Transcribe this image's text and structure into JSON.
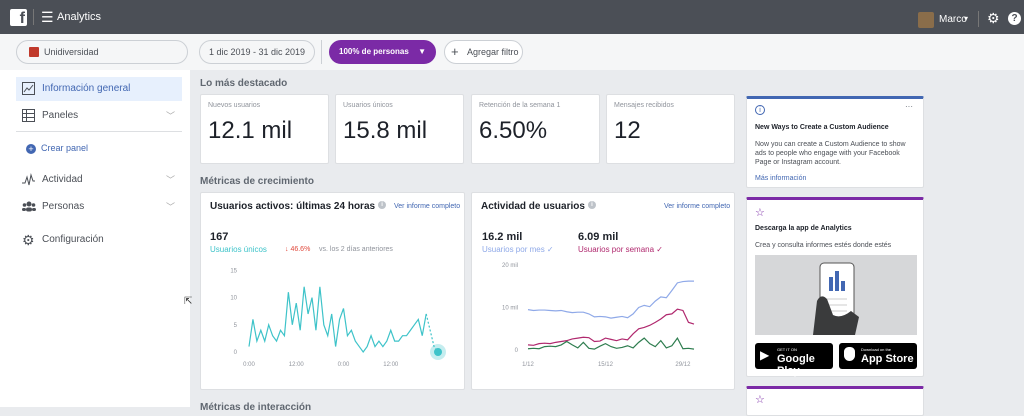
{
  "topbar": {
    "logo": "f",
    "app_title": "Analytics",
    "user_name": "Marco"
  },
  "filters": {
    "entity": "Unidiversidad",
    "date_range": "1 dic 2019 - 31 dic 2019",
    "audience": "100% de personas",
    "add_filter": "Agregar filtro"
  },
  "sidebar": {
    "items": [
      {
        "label": "Información general",
        "icon": "trend-icon"
      },
      {
        "label": "Paneles",
        "icon": "dashboard-icon"
      },
      {
        "label": "Actividad",
        "icon": "activity-icon"
      },
      {
        "label": "Personas",
        "icon": "people-icon"
      },
      {
        "label": "Configuración",
        "icon": "gear-icon"
      }
    ],
    "create_panel": "Crear panel"
  },
  "highlights": {
    "title": "Lo más destacado",
    "stats": [
      {
        "label": "Nuevos usuarios",
        "value": "12.1 mil"
      },
      {
        "label": "Usuarios únicos",
        "value": "15.8 mil"
      },
      {
        "label": "Retención de la semana 1",
        "value": "6.50%"
      },
      {
        "label": "Mensajes recibidos",
        "value": "12"
      }
    ]
  },
  "growth": {
    "title": "Métricas de crecimiento",
    "active_users": {
      "title": "Usuarios activos: últimas 24 horas",
      "link": "Ver informe completo",
      "count": "167",
      "series_label": "Usuarios únicos",
      "change": "↓ 46.6%",
      "change_text": "vs. los 2 días anteriores"
    },
    "user_activity": {
      "title": "Actividad de usuarios",
      "link": "Ver informe completo",
      "monthly_value": "16.2 mil",
      "monthly_label": "Usuarios por mes",
      "weekly_value": "6.09 mil",
      "weekly_label": "Usuarios por semana"
    }
  },
  "interaction": {
    "title": "Métricas de interacción"
  },
  "right_cards": {
    "audience": {
      "more": "···",
      "title": "New Ways to Create a Custom Audience",
      "body": "Now you can create a Custom Audience to show ads to people who engage with your Facebook Page or Instagram account.",
      "link": "Más información"
    },
    "app": {
      "title": "Descarga la app de Analytics",
      "body": "Crea y consulta informes estés donde estés",
      "google_small": "GET IT ON",
      "google_big": "Google Play",
      "apple_small": "Download on the",
      "apple_big": "App Store"
    }
  },
  "colors": {
    "topbar": "#4b4f56",
    "accent": "#4267b2",
    "audience_pill": "#7b2aa6",
    "teal": "#3ec3c9",
    "monthly": "#8fa9e8",
    "weekly": "#b0286e",
    "third": "#2e7d4f",
    "down": "#e0483b"
  },
  "chart_data": [
    {
      "type": "line",
      "title": "Usuarios activos: últimas 24 horas",
      "x_ticks": [
        "0:00",
        "12:00",
        "0:00",
        "12:00"
      ],
      "y_ticks": [
        0,
        5,
        10,
        15
      ],
      "ylim": [
        0,
        16
      ],
      "xlim": [
        0,
        48
      ],
      "series": [
        {
          "name": "Usuarios únicos",
          "x": [
            0,
            1,
            2,
            3,
            4,
            5,
            6,
            7,
            8,
            9,
            10,
            11,
            12,
            13,
            14,
            15,
            16,
            17,
            18,
            19,
            20,
            21,
            22,
            23,
            24,
            25,
            26,
            27,
            28,
            29,
            30,
            31,
            32,
            33,
            34,
            35,
            36,
            37,
            38,
            39,
            40,
            41,
            42,
            43,
            44,
            45,
            46,
            47,
            48
          ],
          "values": [
            1,
            6,
            2,
            4,
            2,
            5,
            3,
            2,
            4,
            3,
            11,
            5,
            9,
            4,
            12,
            7,
            10,
            4,
            12,
            5,
            3,
            7,
            1,
            6,
            8,
            3,
            4,
            2,
            1,
            0,
            1,
            3,
            1,
            2,
            1,
            2,
            4,
            2,
            2,
            3,
            3,
            4,
            5,
            6,
            3,
            7,
            4,
            1,
            0
          ]
        }
      ]
    },
    {
      "type": "line",
      "title": "Actividad de usuarios",
      "x_ticks": [
        "1/12",
        "15/12",
        "29/12"
      ],
      "y_ticks": [
        "0",
        "10 mil",
        "20 mil"
      ],
      "ylim": [
        0,
        20
      ],
      "series": [
        {
          "name": "Usuarios por mes",
          "x": [
            1,
            2,
            3,
            4,
            5,
            6,
            7,
            8,
            9,
            10,
            11,
            12,
            13,
            14,
            15,
            16,
            17,
            18,
            19,
            20,
            21,
            22,
            23,
            24,
            25,
            26,
            27,
            28,
            29,
            30,
            31
          ],
          "values": [
            9.5,
            9.3,
            9.4,
            9.4,
            9.3,
            9.2,
            9.3,
            9.0,
            8.8,
            8.9,
            8.9,
            8.5,
            7.8,
            7.9,
            7.8,
            7.5,
            7.7,
            7.9,
            7.6,
            8.5,
            10.0,
            10.5,
            10.2,
            11.5,
            12.5,
            12.3,
            14.0,
            15.8,
            16.1,
            16.2,
            16.2
          ]
        },
        {
          "name": "Usuarios por semana",
          "x": [
            1,
            2,
            3,
            4,
            5,
            6,
            7,
            8,
            9,
            10,
            11,
            12,
            13,
            14,
            15,
            16,
            17,
            18,
            19,
            20,
            21,
            22,
            23,
            24,
            25,
            26,
            27,
            28,
            29,
            30,
            31
          ],
          "values": [
            1.2,
            1.1,
            1.5,
            1.6,
            1.5,
            1.8,
            2.0,
            2.2,
            2.6,
            2.8,
            3.0,
            2.9,
            2.0,
            2.1,
            2.8,
            2.5,
            2.2,
            2.6,
            2.4,
            3.8,
            5.0,
            5.3,
            5.8,
            6.5,
            7.3,
            8.3,
            8.5,
            9.6,
            9.3,
            6.5,
            6.1
          ]
        },
        {
          "x": [
            1,
            2,
            3,
            4,
            5,
            6,
            7,
            8,
            9,
            10,
            11,
            12,
            13,
            14,
            15,
            16,
            17,
            18,
            19,
            20,
            21,
            22,
            23,
            24,
            25,
            26,
            27,
            28,
            29,
            30,
            31
          ],
          "values": [
            0.3,
            0.4,
            0.3,
            0.8,
            0.9,
            0.8,
            1.2,
            2.0,
            1.2,
            0.5,
            1.8,
            0.4,
            0.2,
            0.9,
            1.5,
            0.8,
            0.4,
            0.6,
            1.0,
            0.5,
            1.8,
            2.8,
            1.5,
            0.8,
            2.2,
            0.5,
            1.0,
            2.8,
            0.3,
            0.4,
            0.2
          ]
        }
      ]
    }
  ]
}
